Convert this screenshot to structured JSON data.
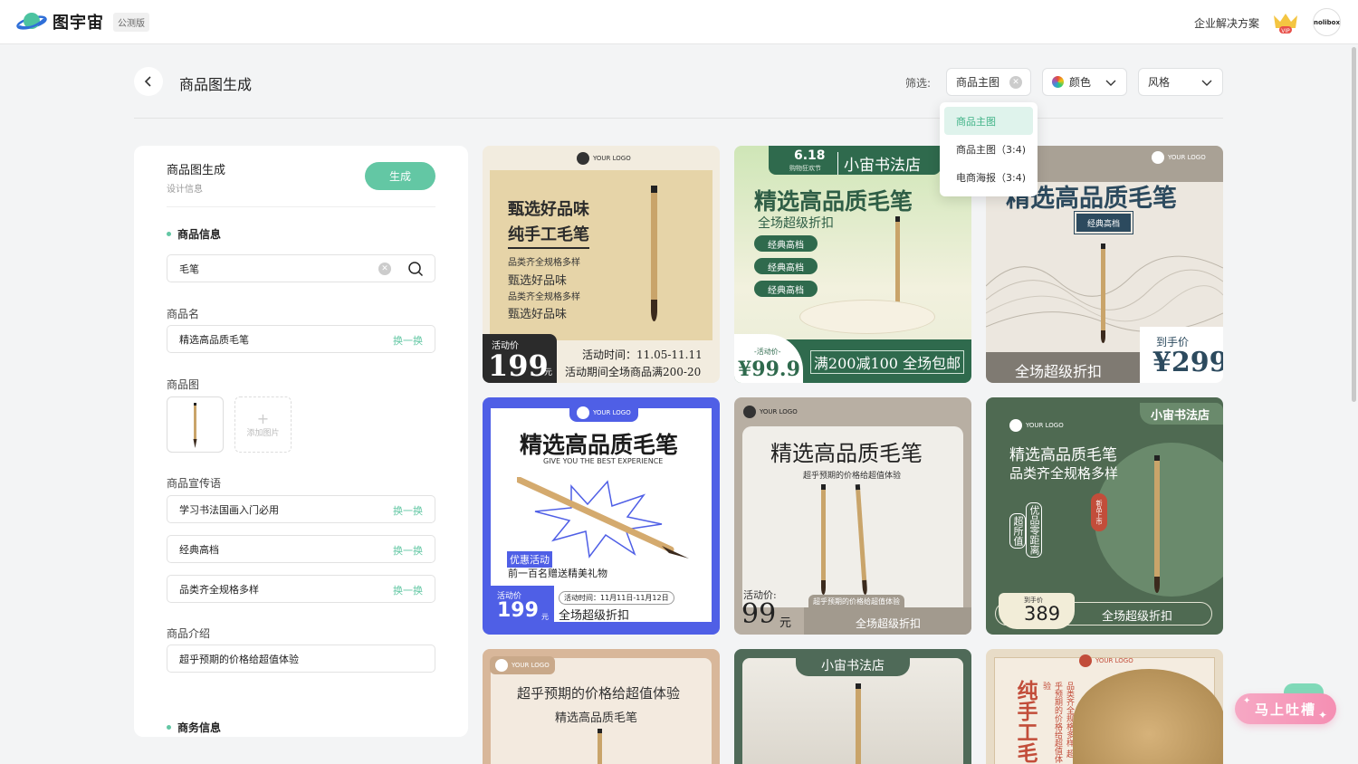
{
  "header": {
    "logo_text": "图宇宙",
    "beta_badge": "公测版",
    "enterprise_link": "企业解决方案",
    "vip_label": "VIP",
    "avatar_text": "nolibox"
  },
  "toolbar": {
    "page_title": "商品图生成",
    "filter_label": "筛选:",
    "filter_type_value": "商品主图",
    "filter_color_label": "颜色",
    "filter_style_label": "风格"
  },
  "dropdown": {
    "items": [
      "商品主图",
      "商品主图（3:4)",
      "电商海报（3:4)"
    ]
  },
  "panel": {
    "title": "商品图生成",
    "subtitle": "设计信息",
    "generate_label": "生成",
    "section_product": "商品信息",
    "search_value": "毛笔",
    "name_label": "商品名",
    "name_value": "精选高品质毛笔",
    "swap_label": "换一换",
    "image_label": "商品图",
    "add_image_label": "添加图片",
    "slogan_label": "商品宣传语",
    "slogans": [
      "学习书法国画入门必用",
      "经典高档",
      "品类齐全规格多样"
    ],
    "intro_label": "商品介绍",
    "intro_value": "超乎预期的价格给超值体验",
    "section_business": "商务信息"
  },
  "cards": {
    "c1": {
      "logo": "YOUR LOGO",
      "line1": "甄选好品味",
      "line2": "纯手工毛笔",
      "s1": "品类齐全规格多样",
      "s2": "甄选好品味",
      "s3": "品类齐全规格多样",
      "s4": "甄选好品味",
      "price_tag": "活动价",
      "price": "199",
      "unit": "元",
      "time": "活动时间：11.05-11.11",
      "promo": "活动期间全场商品满200-20"
    },
    "c2": {
      "date": "6.18",
      "date_sub": "购物狂欢节",
      "shop": "小宙书法店",
      "title": "精选高品质毛笔",
      "sub": "全场超级折扣",
      "tags": [
        "经典高档",
        "经典高档",
        "经典高档"
      ],
      "price_tag": "-活动价-",
      "price": "¥99.9",
      "promo": "满200减100 全场包邮"
    },
    "c3": {
      "logo": "YOUR LOGO",
      "title": "精选高品质毛笔",
      "tag": "经典高档",
      "bottom": "全场超级折扣",
      "price_tag": "到手价",
      "price": "¥299"
    },
    "c4": {
      "logo": "YOUR LOGO",
      "title": "精选高品质毛笔",
      "sub": "GIVE YOU THE BEST EXPERIENCE",
      "badge": "优惠活动",
      "gift": "前一百名赠送精美礼物",
      "price_tag": "活动价",
      "price": "199",
      "unit": "元",
      "time": "活动时间：11月11日-11月12日",
      "promo": "全场超级折扣"
    },
    "c5": {
      "logo": "YOUR LOGO",
      "title": "精选高品质毛笔",
      "sub": "超乎预期的价格给超值体验",
      "price_tag": "活动价:",
      "price": "99",
      "unit": "元",
      "small": "超乎预期的价格给超值体验",
      "promo": "全场超级折扣"
    },
    "c6": {
      "shop": "小宙书法店",
      "logo": "YOUR LOGO",
      "line1": "精选高品质毛笔",
      "line2": "品类齐全规格多样",
      "seal": "新品上市",
      "v1": "超所值",
      "v2": "优品零距离",
      "price_tag": "到手价",
      "price": "389",
      "promo": "全场超级折扣"
    },
    "c7": {
      "logo": "YOUR LOGO",
      "line1": "超乎预期的价格给超值体验",
      "line2": "精选高品质毛笔"
    },
    "c8": {
      "shop": "小宙书法店"
    },
    "c9": {
      "logo": "YOUR LOGO",
      "vertical": "纯手工毛",
      "vsmall": "品类齐全规格多样 超乎预期的价格给超值体验"
    }
  },
  "feedback": {
    "label": "马上吐槽"
  },
  "colors": {
    "accent": "#63c7a4",
    "page_bg": "#f3f4f5",
    "feedback": "#f58fb3"
  }
}
